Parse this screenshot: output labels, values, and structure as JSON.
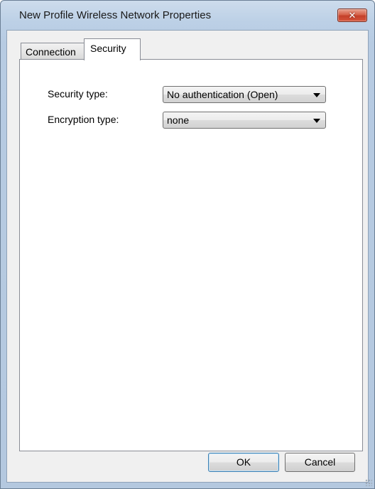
{
  "window": {
    "title": "New Profile Wireless Network Properties",
    "close_label": "✕"
  },
  "tabs": [
    {
      "label": "Connection",
      "selected": false
    },
    {
      "label": "Security",
      "selected": true
    }
  ],
  "security": {
    "security_type_label": "Security type:",
    "security_type_value": "No authentication (Open)",
    "encryption_type_label": "Encryption type:",
    "encryption_type_value": "none"
  },
  "buttons": {
    "ok_label": "OK",
    "cancel_label": "Cancel"
  },
  "colors": {
    "title_bar": "#bcd0e6",
    "close_button": "#c4402a",
    "dialog_background": "#f0f0f0",
    "panel_background": "#ffffff"
  }
}
